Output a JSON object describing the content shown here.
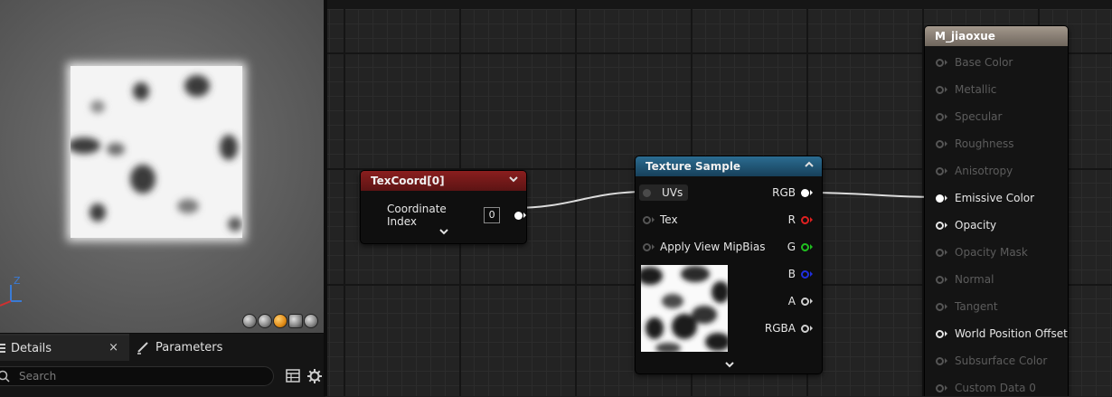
{
  "preview": {
    "axis_label": "Z",
    "toolbar_icons": [
      "cylinder-icon",
      "sphere-icon",
      "plane-icon",
      "cube-icon",
      "custom-mesh-icon"
    ]
  },
  "details_panel": {
    "tabs": [
      {
        "label": "Details",
        "icon": "details-icon",
        "active": true
      },
      {
        "label": "Parameters",
        "icon": "brush-icon",
        "active": false
      }
    ],
    "close_label": "×",
    "search": {
      "placeholder": "Search",
      "value": ""
    }
  },
  "graph": {
    "texcoord_node": {
      "title": "TexCoord[0]",
      "header_color": "#8a1e1e",
      "pin_label": "Coordinate Index",
      "pin_value": "0"
    },
    "texture_sample_node": {
      "title": "Texture Sample",
      "header_color": "#2b6c91",
      "inputs": [
        "UVs",
        "Tex",
        "Apply View MipBias"
      ],
      "outputs": [
        {
          "label": "RGB",
          "color": "#ffffff"
        },
        {
          "label": "R",
          "color": "#e02020"
        },
        {
          "label": "G",
          "color": "#20c020"
        },
        {
          "label": "B",
          "color": "#2030e0"
        },
        {
          "label": "A",
          "color": "#cfcfcf"
        },
        {
          "label": "RGBA",
          "color": "#cfcfcf"
        }
      ]
    },
    "material_node": {
      "title": "M_jiaoxue",
      "header_color": "#a3988c",
      "pins": [
        {
          "label": "Base Color",
          "active": false
        },
        {
          "label": "Metallic",
          "active": false
        },
        {
          "label": "Specular",
          "active": false
        },
        {
          "label": "Roughness",
          "active": false
        },
        {
          "label": "Anisotropy",
          "active": false
        },
        {
          "label": "Emissive Color",
          "active": true,
          "connected": true
        },
        {
          "label": "Opacity",
          "active": true,
          "connected": false
        },
        {
          "label": "Opacity Mask",
          "active": false
        },
        {
          "label": "Normal",
          "active": false
        },
        {
          "label": "Tangent",
          "active": false
        },
        {
          "label": "World Position Offset",
          "active": true,
          "connected": false
        },
        {
          "label": "Subsurface Color",
          "active": false
        },
        {
          "label": "Custom Data 0",
          "active": false
        }
      ]
    }
  }
}
